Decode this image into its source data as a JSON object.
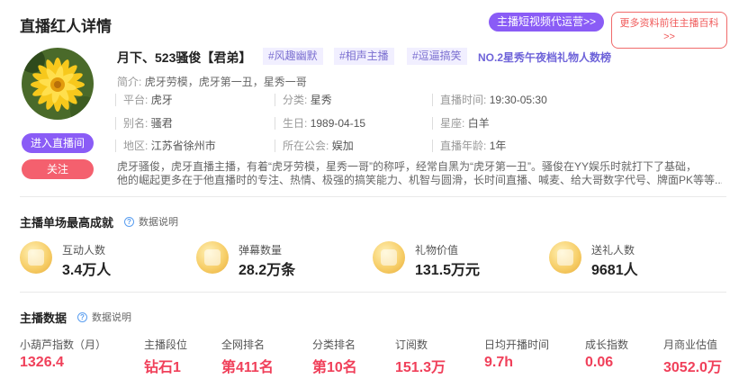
{
  "header": {
    "title": "直播红人详情",
    "promo_button": "主播短视频代运营>>",
    "more_button_line1": "更多资料前往主播百科",
    "more_button_line2": ">>"
  },
  "profile": {
    "name": "月下、523骚俊【君弟】",
    "tags": [
      "#风趣幽默",
      "#相声主播",
      "#逗逼搞笑"
    ],
    "rank_link": "NO.2星秀午夜档礼物人数榜",
    "intro_label": "简介:",
    "intro_text": "虎牙劳模，虎牙第一丑，星秀一哥",
    "enter_button": "进入直播间",
    "follow_button": "关注",
    "info": [
      {
        "label": "平台:",
        "value": "虎牙"
      },
      {
        "label": "分类:",
        "value": "星秀"
      },
      {
        "label": "直播时间:",
        "value": "19:30-05:30"
      },
      {
        "label": "别名:",
        "value": "骚君"
      },
      {
        "label": "生日:",
        "value": "1989-04-15"
      },
      {
        "label": "星座:",
        "value": "白羊"
      },
      {
        "label": "地区:",
        "value": "江苏省徐州市"
      },
      {
        "label": "所在公会:",
        "value": "娱加"
      },
      {
        "label": "直播年龄:",
        "value": "1年"
      }
    ],
    "description_line1": "虎牙骚俊，虎牙直播主播，有着“虎牙劳模，星秀一哥”的称呼，经常自黑为“虎牙第一丑”。骚俊在YY娱乐时就打下了基础，",
    "description_line2": "他的崛起更多在于他直播时的专注、热情、极强的搞笑能力、机智与圆滑，长时间直播、喊麦、给大哥数字代号、牌面PK等等..."
  },
  "achievements": {
    "title": "主播单场最高成就",
    "help_label": "数据说明",
    "items": [
      {
        "label": "互动人数",
        "value": "3.4万人",
        "icon": "users-coin-icon"
      },
      {
        "label": "弹幕数量",
        "value": "28.2万条",
        "icon": "comment-coin-icon"
      },
      {
        "label": "礼物价值",
        "value": "131.5万元",
        "icon": "crown-coin-icon"
      },
      {
        "label": "送礼人数",
        "value": "9681人",
        "icon": "gift-coin-icon"
      }
    ]
  },
  "anchor_data": {
    "title": "主播数据",
    "help_label": "数据说明",
    "metrics": [
      {
        "label": "小葫芦指数（月）",
        "value": "1326.4"
      },
      {
        "label": "主播段位",
        "value": "钻石1"
      },
      {
        "label": "全网排名",
        "value": "第411名"
      },
      {
        "label": "分类排名",
        "value": "第10名"
      },
      {
        "label": "订阅数",
        "value": "151.3万"
      },
      {
        "label": "日均开播时间",
        "value": "9.7h"
      },
      {
        "label": "成长指数",
        "value": "0.06"
      },
      {
        "label": "月商业估值",
        "value": "3052.0万"
      }
    ]
  }
}
